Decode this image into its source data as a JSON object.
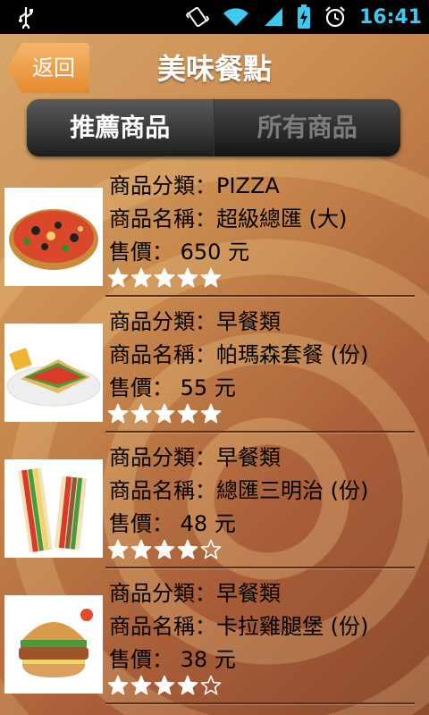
{
  "status": {
    "time": "16:41"
  },
  "header": {
    "back_label": "返回",
    "title": "美味餐點"
  },
  "tabs": [
    {
      "label": "推薦商品",
      "active": true
    },
    {
      "label": "所有商品",
      "active": false
    }
  ],
  "labels": {
    "category": "商品分類：",
    "name": "商品名稱：",
    "price": "售價：",
    "unit": "元"
  },
  "items": [
    {
      "category": "PIZZA",
      "name": "超級總匯 (大)",
      "price": "650",
      "rating": 5,
      "image": "pizza"
    },
    {
      "category": "早餐類",
      "name": "帕瑪森套餐 (份)",
      "price": "55",
      "rating": 5,
      "image": "sandwich-plate"
    },
    {
      "category": "早餐類",
      "name": "總匯三明治 (份)",
      "price": "48",
      "rating": 4,
      "image": "club-sandwich"
    },
    {
      "category": "早餐類",
      "name": "卡拉雞腿堡 (份)",
      "price": "38",
      "rating": 4,
      "image": "chicken-burger"
    }
  ],
  "max_rating": 5
}
